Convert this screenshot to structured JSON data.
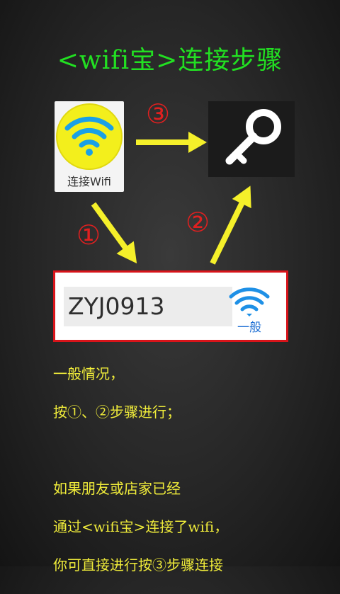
{
  "title": "<wifi宝>连接步骤",
  "app_icon": {
    "label": "连接Wifi",
    "icon": "wifi-icon"
  },
  "key_icon": {
    "icon": "key-icon"
  },
  "network": {
    "ssid": "ZYJ0913",
    "signal_label": "一般",
    "icon": "wifi-signal-icon"
  },
  "steps": {
    "one": "①",
    "two": "②",
    "three": "③"
  },
  "description": {
    "line1": "一般情况，",
    "line2": "按①、②步骤进行；",
    "line3": "",
    "line4": "如果朋友或店家已经",
    "line5": "通过<wifi宝>连接了wifi，",
    "line6": "你可直接进行按③步骤连接"
  },
  "colors": {
    "title": "#22e022",
    "arrow": "#f5f02a",
    "step": "#e02020",
    "text": "#f0ec3a",
    "border": "#d8141a"
  }
}
